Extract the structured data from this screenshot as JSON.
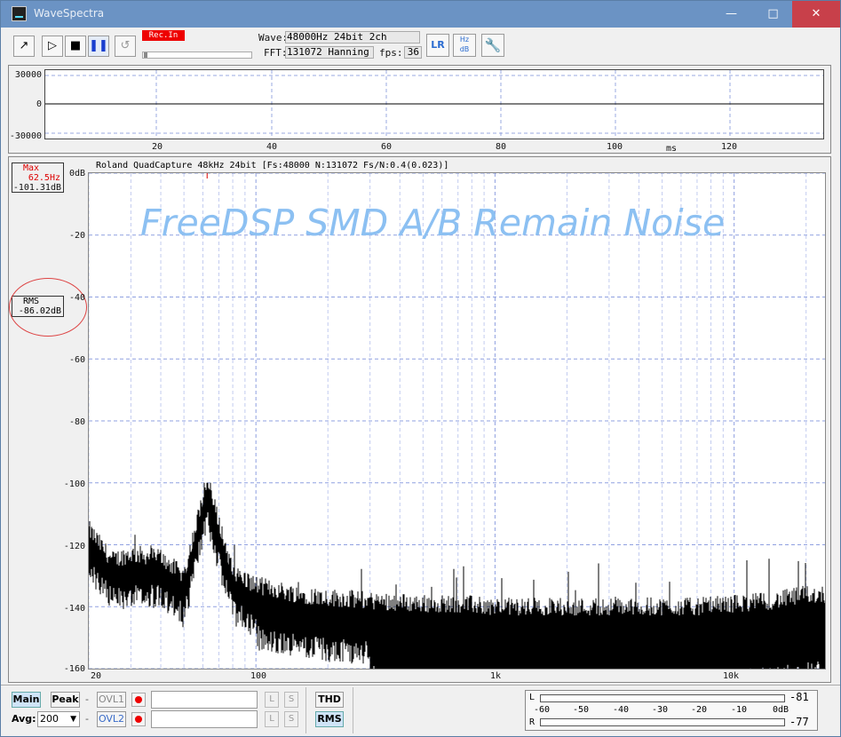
{
  "window": {
    "title": "WaveSpectra"
  },
  "toolbar": {
    "rec_label": "Rec.In",
    "wave_label": "Wave:",
    "wave_value": "48000Hz 24bit 2ch",
    "fft_label": "FFT:",
    "fft_value": "131072 Hanning",
    "fps_label": "fps:",
    "fps_value": "36"
  },
  "wave_view": {
    "y_ticks": [
      "30000",
      "0",
      "-30000"
    ],
    "x_ticks": [
      "20",
      "40",
      "60",
      "80",
      "100",
      "120"
    ],
    "x_unit": "ms"
  },
  "spectrum": {
    "header": "Roland QuadCapture 48kHz 24bit  [Fs:48000 N:131072 Fs/N:0.4(0.023)]",
    "overlay_title": "FreeDSP SMD A/B Remain Noise",
    "max_box": {
      "label": "Max",
      "freq": "62.5Hz",
      "level": "-101.31dB"
    },
    "rms_box": {
      "label": "RMS",
      "level": "-86.02dB"
    },
    "y_ticks": [
      "0dB",
      "-20",
      "-40",
      "-60",
      "-80",
      "-100",
      "-120",
      "-140",
      "-160"
    ],
    "x_ticks": [
      "20",
      "100",
      "1k",
      "10k"
    ]
  },
  "bottom": {
    "main_label": "Main",
    "peak_label": "Peak",
    "ovl1_label": "OVL1",
    "ovl2_label": "OVL2",
    "avg_label": "Avg:",
    "avg_value": "200",
    "l_label": "L",
    "s_label": "S",
    "thd_label": "THD",
    "rms_label": "RMS",
    "dash": "-"
  },
  "meter": {
    "ch_l": "L",
    "ch_r": "R",
    "scale": [
      "-60",
      "-50",
      "-40",
      "-30",
      "-20",
      "-10",
      "0dB"
    ],
    "l_value": "-81",
    "r_value": "-77"
  },
  "chart_data": {
    "type": "line",
    "title": "",
    "xlabel": "",
    "ylabel": "",
    "x_scale": "log",
    "xlim": [
      20,
      24000
    ],
    "ylim": [
      -160,
      0
    ],
    "grid": true,
    "series": [
      {
        "x": [
          20,
          25,
          30,
          40,
          50,
          62.5,
          80,
          100,
          150,
          200,
          300,
          500,
          700,
          1000,
          2000,
          3000,
          5000,
          7000,
          10000,
          15000,
          20000,
          23000
        ],
        "y": [
          -118,
          -128,
          -126,
          -127,
          -133,
          -102,
          -132,
          -136,
          -139,
          -140,
          -141,
          -142,
          -142,
          -143,
          -143,
          -143,
          -143,
          -143,
          -142,
          -141,
          -139,
          -139
        ]
      }
    ]
  }
}
